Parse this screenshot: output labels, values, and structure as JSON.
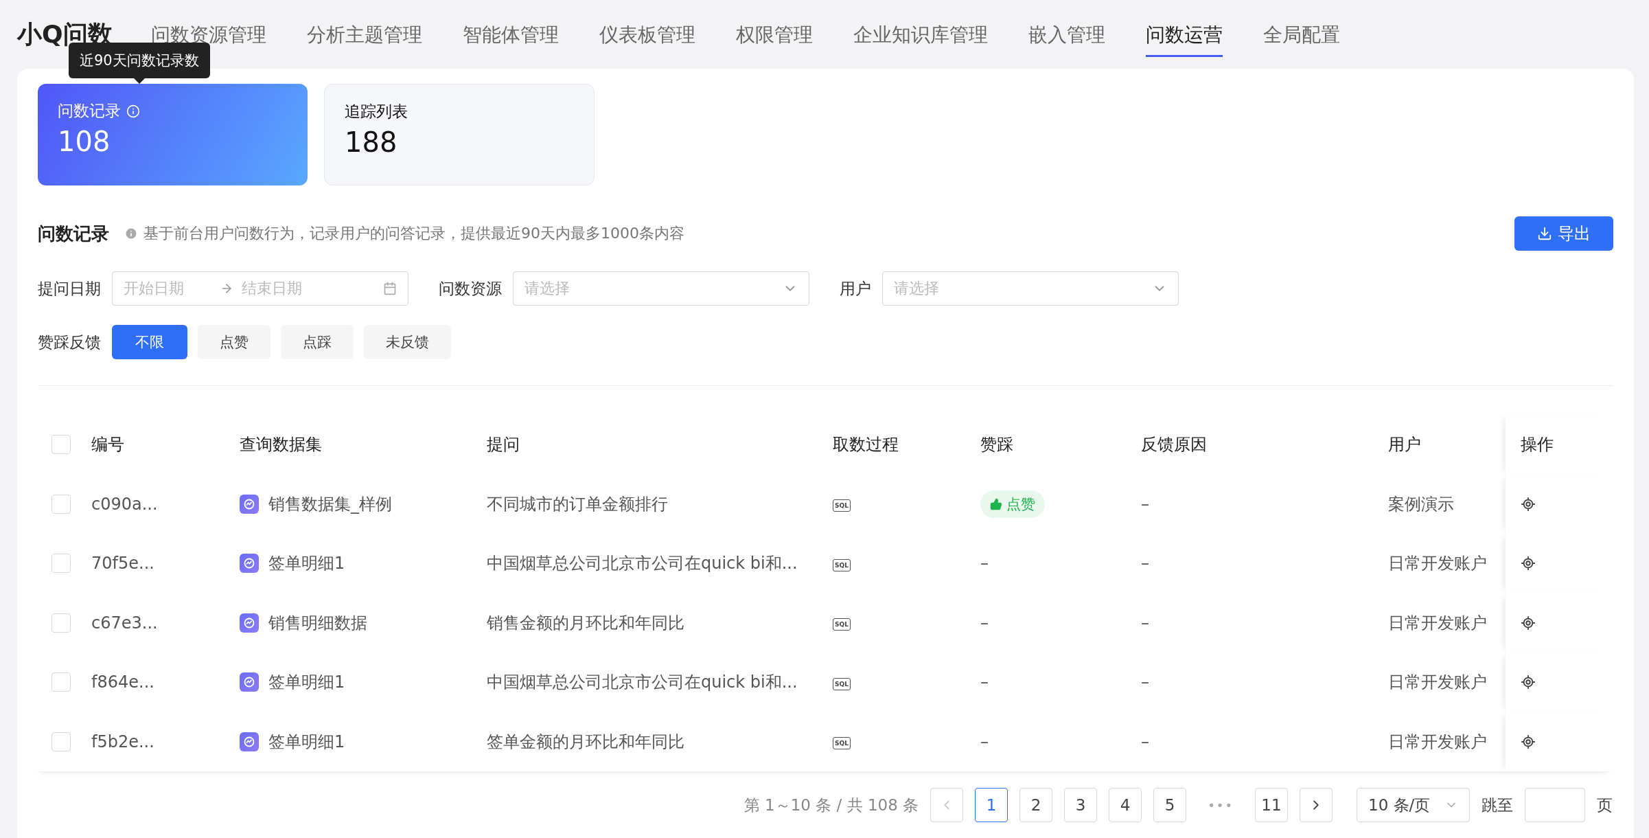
{
  "nav": {
    "logo": "小Q问数",
    "tabs": [
      {
        "label": "问数资源管理",
        "selected": false
      },
      {
        "label": "分析主题管理",
        "selected": false
      },
      {
        "label": "智能体管理",
        "selected": false
      },
      {
        "label": "仪表板管理",
        "selected": false
      },
      {
        "label": "权限管理",
        "selected": false
      },
      {
        "label": "企业知识库管理",
        "selected": false
      },
      {
        "label": "嵌入管理",
        "selected": false
      },
      {
        "label": "问数运营",
        "selected": true
      },
      {
        "label": "全局配置",
        "selected": false
      }
    ]
  },
  "tooltip": "近90天问数记录数",
  "stats": [
    {
      "label": "问数记录",
      "value": "108",
      "selected": true,
      "info": true
    },
    {
      "label": "追踪列表",
      "value": "188",
      "selected": false,
      "info": false
    }
  ],
  "section": {
    "title": "问数记录",
    "description": "基于前台用户问数行为，记录用户的问答记录，提供最近90天内最多1000条内容",
    "export_button": "导出"
  },
  "filters": {
    "date": {
      "label": "提问日期",
      "start_placeholder": "开始日期",
      "end_placeholder": "结束日期"
    },
    "resource": {
      "label": "问数资源",
      "placeholder": "请选择"
    },
    "user": {
      "label": "用户",
      "placeholder": "请选择"
    }
  },
  "feedback": {
    "label": "赞踩反馈",
    "options": [
      {
        "label": "不限",
        "selected": true
      },
      {
        "label": "点赞",
        "selected": false
      },
      {
        "label": "点踩",
        "selected": false
      },
      {
        "label": "未反馈",
        "selected": false
      }
    ]
  },
  "table": {
    "all_checked": false,
    "columns": [
      "编号",
      "查询数据集",
      "提问",
      "取数过程",
      "赞踩",
      "反馈原因",
      "用户",
      "操作"
    ],
    "rows": [
      {
        "checked": false,
        "id": "c090a...",
        "dataset": "销售数据集_样例",
        "question": "不同城市的订单金额排行",
        "process": "SQL",
        "feedback": {
          "kind": "like",
          "text": "点赞"
        },
        "reason": "–",
        "user": "案例演示"
      },
      {
        "checked": false,
        "id": "70f5e...",
        "dataset": "签单明细1",
        "question": "中国烟草总公司北京市公司在quick bi和...",
        "process": "SQL",
        "feedback": {
          "kind": "none",
          "text": "–"
        },
        "reason": "–",
        "user": "日常开发账户"
      },
      {
        "checked": false,
        "id": "c67e3...",
        "dataset": "销售明细数据",
        "question": "销售金额的月环比和年同比",
        "process": "SQL",
        "feedback": {
          "kind": "none",
          "text": "–"
        },
        "reason": "–",
        "user": "日常开发账户"
      },
      {
        "checked": false,
        "id": "f864e...",
        "dataset": "签单明细1",
        "question": "中国烟草总公司北京市公司在quick bi和...",
        "process": "SQL",
        "feedback": {
          "kind": "none",
          "text": "–"
        },
        "reason": "–",
        "user": "日常开发账户"
      },
      {
        "checked": false,
        "id": "f5b2e...",
        "dataset": "签单明细1",
        "question": "签单金额的月环比和年同比",
        "process": "SQL",
        "feedback": {
          "kind": "none",
          "text": "–"
        },
        "reason": "–",
        "user": "日常开发账户"
      }
    ]
  },
  "pagination": {
    "summary": "第 1～10 条 / 共 108 条",
    "prev_disabled": true,
    "pages": [
      {
        "label": "1",
        "selected": true
      },
      {
        "label": "2",
        "selected": false
      },
      {
        "label": "3",
        "selected": false
      },
      {
        "label": "4",
        "selected": false
      },
      {
        "label": "5",
        "selected": false
      }
    ],
    "ellipsis": "•••",
    "last_page": "11",
    "page_size": "10 条/页",
    "jump_label": "跳至",
    "jump_suffix": "页"
  }
}
